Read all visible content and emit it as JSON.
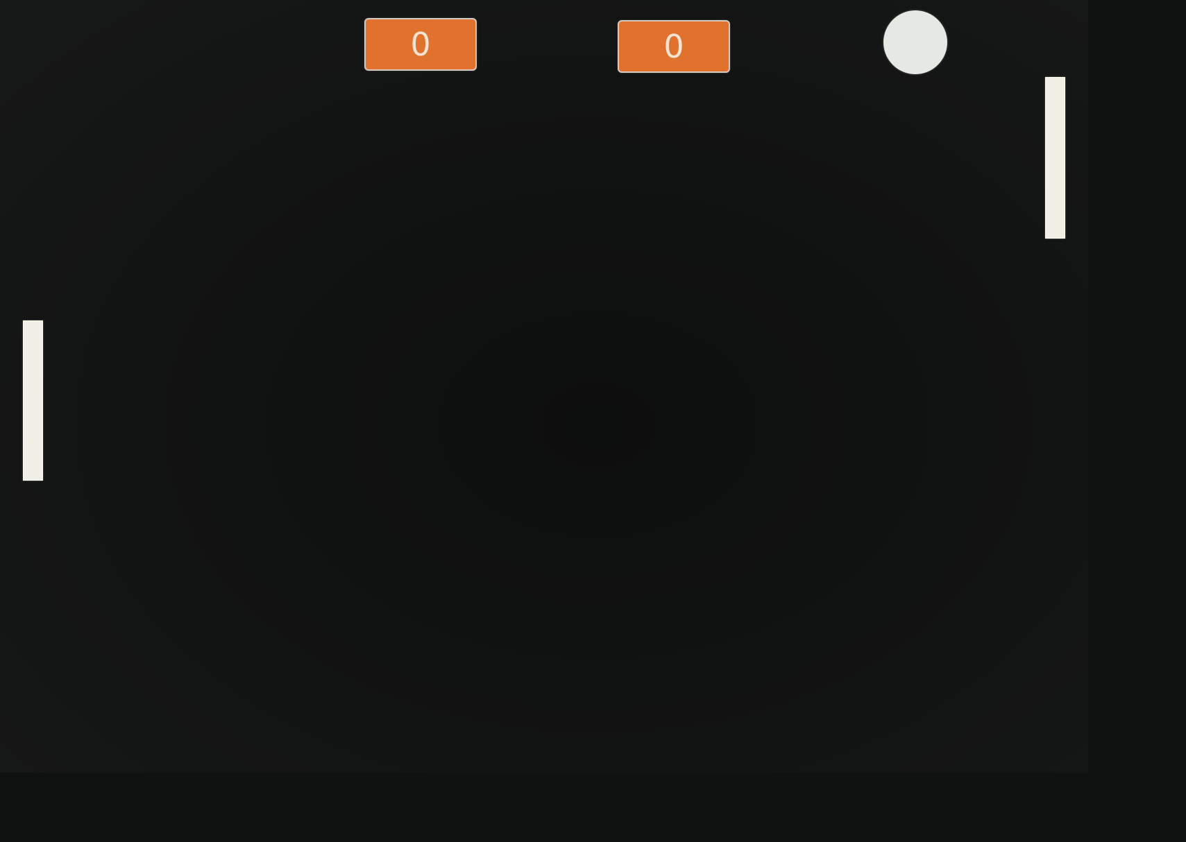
{
  "game": {
    "scores": {
      "left": "0",
      "right": "0"
    },
    "colors": {
      "background": "#121313",
      "score_box": "#e0722e",
      "score_text": "#f3e3d2",
      "paddle": "#f0efe6",
      "ball": "#e6e8e4"
    }
  }
}
